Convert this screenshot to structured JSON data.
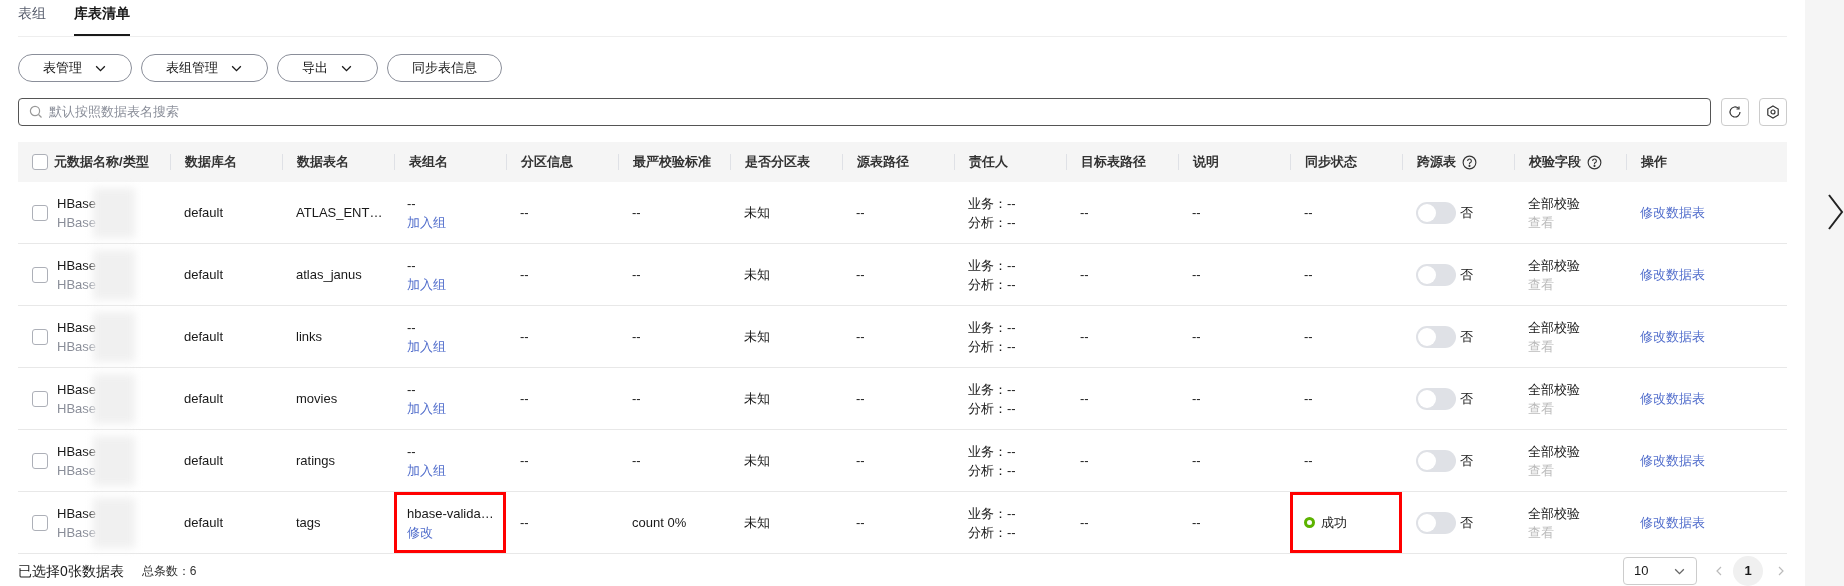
{
  "tabs": [
    {
      "label": "表组",
      "selected": false
    },
    {
      "label": "库表清单",
      "selected": true
    }
  ],
  "toolbar": [
    {
      "label": "表管理",
      "dropdown": true
    },
    {
      "label": "表组管理",
      "dropdown": true
    },
    {
      "label": "导出",
      "dropdown": true
    },
    {
      "label": "同步表信息",
      "dropdown": false
    }
  ],
  "search": {
    "placeholder": "默认按照数据表名搜索"
  },
  "table": {
    "all_checked": false,
    "columns": [
      {
        "label": "元数据名称/类型",
        "help": false
      },
      {
        "label": "数据库名",
        "help": false
      },
      {
        "label": "数据表名",
        "help": false
      },
      {
        "label": "表组名",
        "help": false
      },
      {
        "label": "分区信息",
        "help": false
      },
      {
        "label": "最严校验标准",
        "help": false
      },
      {
        "label": "是否分区表",
        "help": false
      },
      {
        "label": "源表路径",
        "help": false
      },
      {
        "label": "责任人",
        "help": false
      },
      {
        "label": "目标表路径",
        "help": false
      },
      {
        "label": "说明",
        "help": false
      },
      {
        "label": "同步状态",
        "help": false
      },
      {
        "label": "跨源表",
        "help": true
      },
      {
        "label": "校验字段",
        "help": true
      },
      {
        "label": "操作",
        "help": false
      }
    ],
    "rows": [
      {
        "checked": false,
        "meta_name": "HBase",
        "meta_type": "HBase",
        "database": "default",
        "table": "ATLAS_ENT…",
        "group": "--",
        "group_action": "加入组",
        "group_highlighted": false,
        "partition": "--",
        "strictest": "--",
        "partitioned": "未知",
        "source_path": "--",
        "owner_business": "业务：--",
        "owner_analysis": "分析：--",
        "target_path": "--",
        "description": "--",
        "sync": {
          "text": "--",
          "kind": "plain",
          "highlighted": false
        },
        "cross_source": {
          "on": false,
          "label": "否"
        },
        "check_fields": "全部校验",
        "check_view": "查看",
        "action": "修改数据表"
      },
      {
        "checked": false,
        "meta_name": "HBase",
        "meta_type": "HBase",
        "database": "default",
        "table": "atlas_janus",
        "group": "--",
        "group_action": "加入组",
        "group_highlighted": false,
        "partition": "--",
        "strictest": "--",
        "partitioned": "未知",
        "source_path": "--",
        "owner_business": "业务：--",
        "owner_analysis": "分析：--",
        "target_path": "--",
        "description": "--",
        "sync": {
          "text": "--",
          "kind": "plain",
          "highlighted": false
        },
        "cross_source": {
          "on": false,
          "label": "否"
        },
        "check_fields": "全部校验",
        "check_view": "查看",
        "action": "修改数据表"
      },
      {
        "checked": false,
        "meta_name": "HBase",
        "meta_type": "HBase",
        "database": "default",
        "table": "links",
        "group": "--",
        "group_action": "加入组",
        "group_highlighted": false,
        "partition": "--",
        "strictest": "--",
        "partitioned": "未知",
        "source_path": "--",
        "owner_business": "业务：--",
        "owner_analysis": "分析：--",
        "target_path": "--",
        "description": "--",
        "sync": {
          "text": "--",
          "kind": "plain",
          "highlighted": false
        },
        "cross_source": {
          "on": false,
          "label": "否"
        },
        "check_fields": "全部校验",
        "check_view": "查看",
        "action": "修改数据表"
      },
      {
        "checked": false,
        "meta_name": "HBase",
        "meta_type": "HBase",
        "database": "default",
        "table": "movies",
        "group": "--",
        "group_action": "加入组",
        "group_highlighted": false,
        "partition": "--",
        "strictest": "--",
        "partitioned": "未知",
        "source_path": "--",
        "owner_business": "业务：--",
        "owner_analysis": "分析：--",
        "target_path": "--",
        "description": "--",
        "sync": {
          "text": "--",
          "kind": "plain",
          "highlighted": false
        },
        "cross_source": {
          "on": false,
          "label": "否"
        },
        "check_fields": "全部校验",
        "check_view": "查看",
        "action": "修改数据表"
      },
      {
        "checked": false,
        "meta_name": "HBase",
        "meta_type": "HBase",
        "database": "default",
        "table": "ratings",
        "group": "--",
        "group_action": "加入组",
        "group_highlighted": false,
        "partition": "--",
        "strictest": "--",
        "partitioned": "未知",
        "source_path": "--",
        "owner_business": "业务：--",
        "owner_analysis": "分析：--",
        "target_path": "--",
        "description": "--",
        "sync": {
          "text": "--",
          "kind": "plain",
          "highlighted": false
        },
        "cross_source": {
          "on": false,
          "label": "否"
        },
        "check_fields": "全部校验",
        "check_view": "查看",
        "action": "修改数据表"
      },
      {
        "checked": false,
        "meta_name": "HBase",
        "meta_type": "HBase",
        "database": "default",
        "table": "tags",
        "group": "hbase-valida…",
        "group_action": "修改",
        "group_highlighted": true,
        "partition": "--",
        "strictest": "count 0%",
        "partitioned": "未知",
        "source_path": "--",
        "owner_business": "业务：--",
        "owner_analysis": "分析：--",
        "target_path": "--",
        "description": "--",
        "sync": {
          "text": "成功",
          "kind": "success",
          "highlighted": true
        },
        "cross_source": {
          "on": false,
          "label": "否"
        },
        "check_fields": "全部校验",
        "check_view": "查看",
        "action": "修改数据表"
      }
    ]
  },
  "footer": {
    "selected_text": "已选择0张数据表",
    "total": "总条数：6",
    "page_size": "10",
    "pages": [
      {
        "label": "1",
        "selected": true
      }
    ]
  }
}
